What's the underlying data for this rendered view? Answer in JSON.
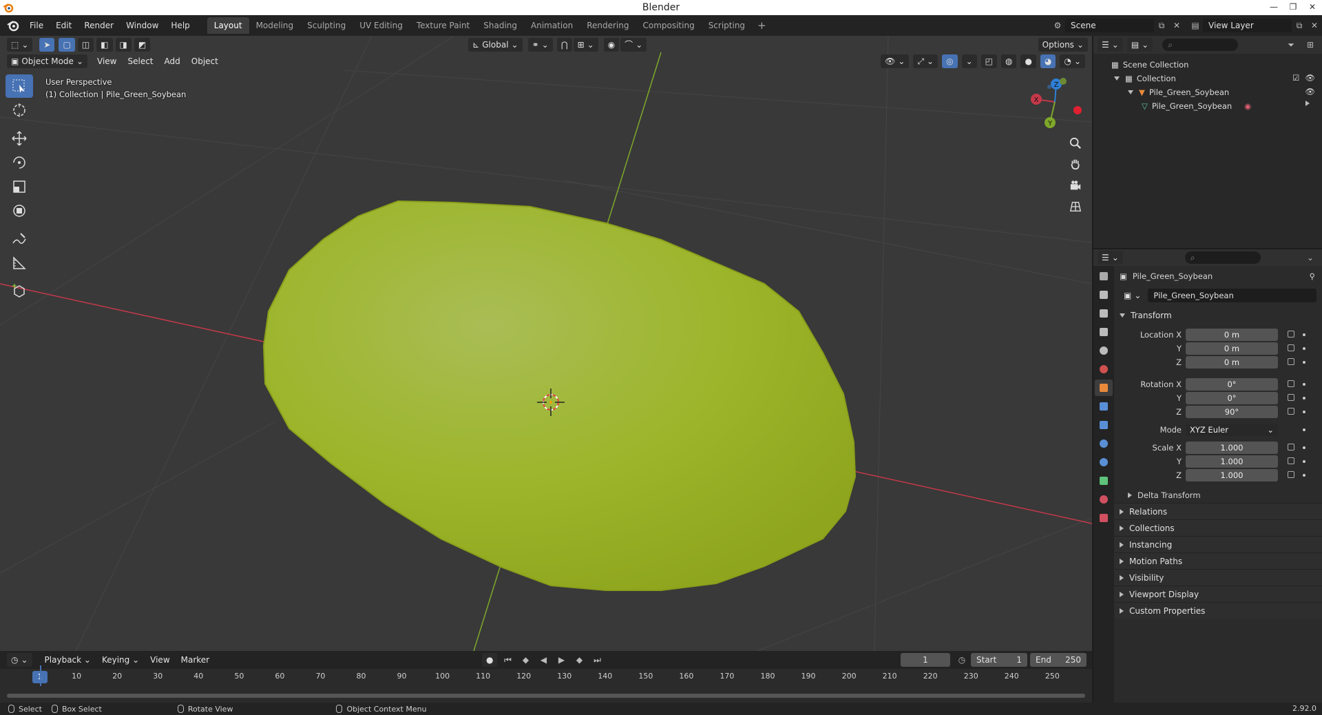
{
  "window": {
    "title": "Blender",
    "minimize": "—",
    "restore": "❐",
    "close": "✕"
  },
  "menu": [
    "File",
    "Edit",
    "Render",
    "Window",
    "Help"
  ],
  "workspaces": [
    "Layout",
    "Modeling",
    "Sculpting",
    "UV Editing",
    "Texture Paint",
    "Shading",
    "Animation",
    "Rendering",
    "Compositing",
    "Scripting"
  ],
  "workspace_add": "+",
  "scene": {
    "name": "Scene"
  },
  "view_layer": {
    "name": "View Layer"
  },
  "viewport": {
    "mode": "Object Mode",
    "menus": [
      "View",
      "Select",
      "Add",
      "Object"
    ],
    "orientation": "Global",
    "options_label": "Options",
    "info_line1": "User Perspective",
    "info_line2": "(1) Collection | Pile_Green_Soybean",
    "gizmo": {
      "x": "X",
      "y": "Y",
      "z": "Z"
    },
    "colors": {
      "background": "#393939",
      "object": "#9fb52a",
      "x_axis": "#c5394a",
      "y_axis": "#7fa82a"
    }
  },
  "timeline": {
    "menus": [
      "Playback",
      "Keying",
      "View",
      "Marker"
    ],
    "current_frame": "1",
    "start_label": "Start",
    "start": "1",
    "end_label": "End",
    "end": "250",
    "ticks": [
      "1",
      "10",
      "20",
      "30",
      "40",
      "50",
      "60",
      "70",
      "80",
      "90",
      "100",
      "110",
      "120",
      "130",
      "140",
      "150",
      "160",
      "170",
      "180",
      "190",
      "200",
      "210",
      "220",
      "230",
      "240",
      "250"
    ]
  },
  "outliner": {
    "items": [
      {
        "label": "Scene Collection"
      },
      {
        "label": "Collection"
      },
      {
        "label": "Pile_Green_Soybean"
      },
      {
        "label": "Pile_Green_Soybean"
      }
    ]
  },
  "properties": {
    "object_name": "Pile_Green_Soybean",
    "datablock_name": "Pile_Green_Soybean",
    "transform_label": "Transform",
    "location": {
      "label_x": "Location X",
      "label_y": "Y",
      "label_z": "Z",
      "x": "0 m",
      "y": "0 m",
      "z": "0 m"
    },
    "rotation": {
      "label_x": "Rotation X",
      "label_y": "Y",
      "label_z": "Z",
      "x": "0°",
      "y": "0°",
      "z": "90°"
    },
    "mode": {
      "label": "Mode",
      "value": "XYZ Euler"
    },
    "scale": {
      "label_x": "Scale X",
      "label_y": "Y",
      "label_z": "Z",
      "x": "1.000",
      "y": "1.000",
      "z": "1.000"
    },
    "delta_transform": "Delta Transform",
    "sections": [
      "Relations",
      "Collections",
      "Instancing",
      "Motion Paths",
      "Visibility",
      "Viewport Display",
      "Custom Properties"
    ]
  },
  "statusbar": {
    "select": "Select",
    "box_select": "Box Select",
    "rotate_view": "Rotate View",
    "context_menu": "Object Context Menu",
    "version": "2.92.0"
  }
}
